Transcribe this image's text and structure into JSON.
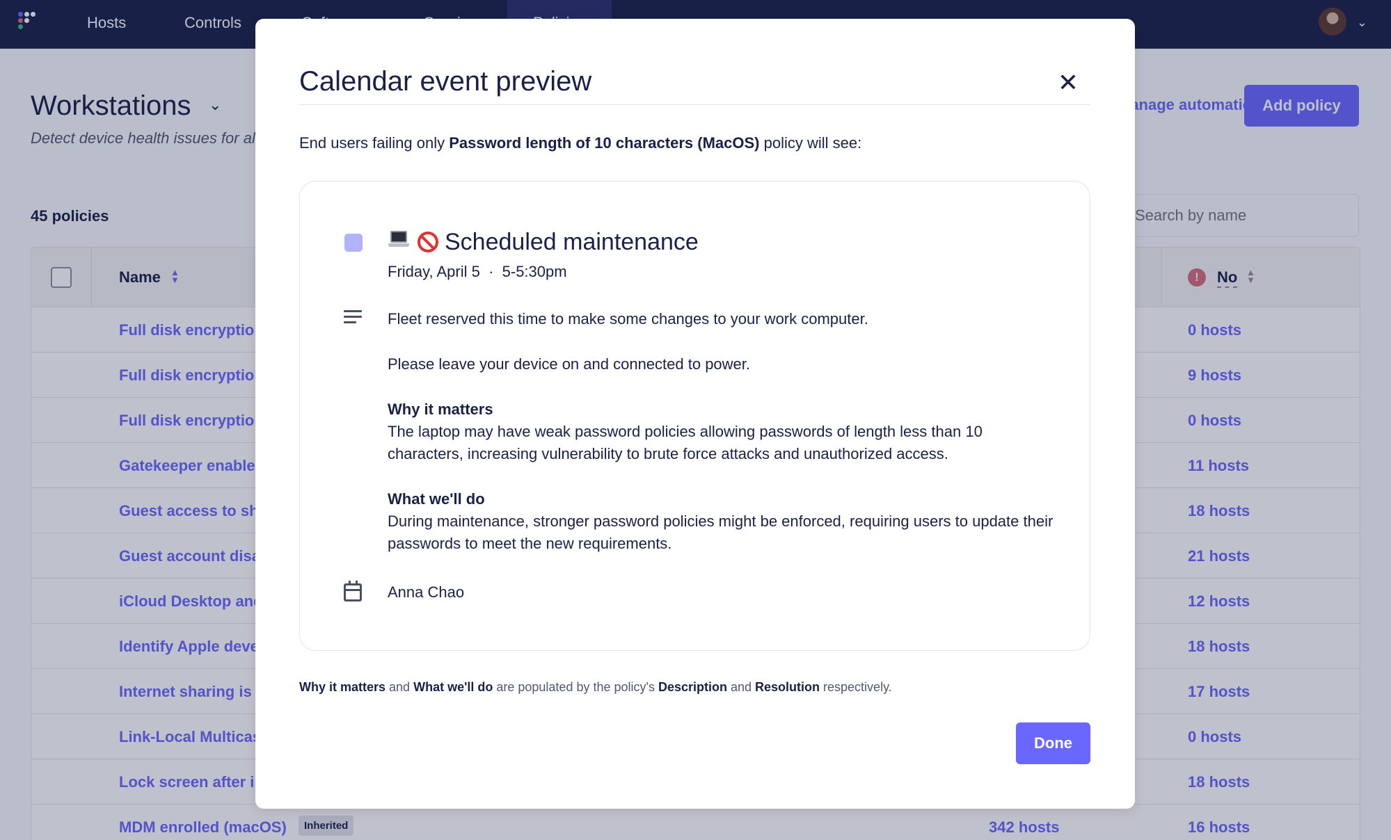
{
  "nav": {
    "items": [
      "Hosts",
      "Controls",
      "Software",
      "Queries",
      "Policies"
    ],
    "active_index": 4
  },
  "page": {
    "team_name": "Workstations",
    "subtitle": "Detect device health issues for all hosts assigned to this team.",
    "manage_automations_label": "Manage automations",
    "add_policy_label": "Add policy",
    "policy_count": "45 policies",
    "search_placeholder": "Search by name"
  },
  "table": {
    "columns": {
      "name": "Name",
      "no": "No"
    },
    "rows": [
      {
        "name": "Full disk encryption enabled (Linux)",
        "yes": "",
        "no": "0 hosts",
        "inherited": ""
      },
      {
        "name": "Full disk encryption enabled (macOS)",
        "yes": "",
        "no": "9 hosts",
        "inherited": ""
      },
      {
        "name": "Full disk encryption enabled (Windows)",
        "yes": "",
        "no": "0 hosts",
        "inherited": ""
      },
      {
        "name": "Gatekeeper enabled (macOS)",
        "yes": "",
        "no": "11 hosts",
        "inherited": ""
      },
      {
        "name": "Guest access to shared folders disabled (macOS)",
        "yes": "",
        "no": "18 hosts",
        "inherited": ""
      },
      {
        "name": "Guest account disabled (macOS)",
        "yes": "",
        "no": "21 hosts",
        "inherited": ""
      },
      {
        "name": "iCloud Desktop and Documents disabled (macOS)",
        "yes": "",
        "no": "12 hosts",
        "inherited": ""
      },
      {
        "name": "Identify Apple development secrets (macOS)",
        "yes": "",
        "no": "18 hosts",
        "inherited": ""
      },
      {
        "name": "Internet sharing is blocked (macOS)",
        "yes": "",
        "no": "17 hosts",
        "inherited": ""
      },
      {
        "name": "Link-Local Multicast Name Resolution disabled (Windows)",
        "yes": "",
        "no": "0 hosts",
        "inherited": ""
      },
      {
        "name": "Lock screen after inactivity (macOS)",
        "yes": "",
        "no": "18 hosts",
        "inherited": ""
      },
      {
        "name": "MDM enrolled (macOS)",
        "yes": "342 hosts",
        "no": "16 hosts",
        "inherited": "Inherited"
      }
    ]
  },
  "modal": {
    "title": "Calendar event preview",
    "intro_prefix": "End users failing only ",
    "intro_policy": "Password length of 10 characters (MacOS)",
    "intro_suffix": " policy will see:",
    "event": {
      "swatch_color": "#b2b2fc",
      "emoji_names": [
        "laptop-emoji",
        "no-entry-emoji"
      ],
      "title": "Scheduled maintenance",
      "when": "Friday, April 5  ·  5-5:30pm",
      "description_1": "Fleet reserved this time to make some changes to your work computer.",
      "description_2": "Please leave your device on and connected to power.",
      "why_heading": "Why it matters",
      "why_text": "The laptop may have weak password policies allowing passwords of length less than 10 characters, increasing vulnerability to brute force attacks and unauthorized access.",
      "what_heading": "What we'll do",
      "what_text": "During maintenance, stronger password policies might be enforced, requiring users to update their passwords to meet the new requirements.",
      "organizer": "Anna Chao"
    },
    "footnote": {
      "why": "Why it matters",
      "and1": " and ",
      "what": "What we'll do",
      "mid": " are populated by the policy's ",
      "description": "Description",
      "and2": " and ",
      "resolution": "Resolution",
      "end": " respectively."
    },
    "done_label": "Done"
  },
  "colors": {
    "nav_bg": "#192147",
    "accent": "#6a67fe",
    "text": "#192147",
    "failing_icon": "#d66c7b"
  }
}
